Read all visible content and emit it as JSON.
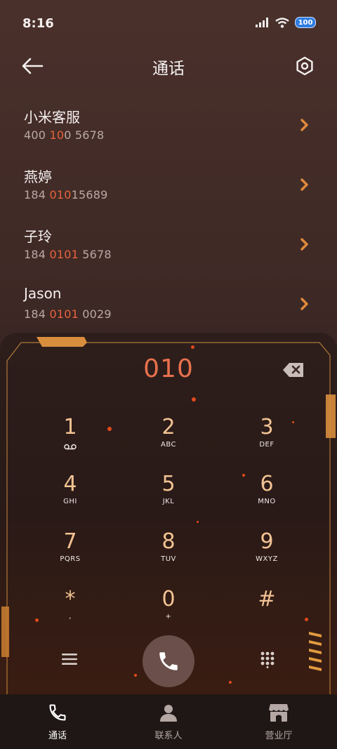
{
  "status": {
    "time": "8:16",
    "battery": "100"
  },
  "header": {
    "title": "通话"
  },
  "contacts": [
    {
      "name": "小米客服",
      "num_a": "400 ",
      "num_hl": "10",
      "num_b": "0 5678"
    },
    {
      "name": "燕婷",
      "num_a": "184 ",
      "num_hl": "010",
      "num_b": "15689"
    },
    {
      "name": "子玲",
      "num_a": "184 ",
      "num_hl": "0101",
      "num_b": " 5678"
    },
    {
      "name": "Jason",
      "num_a": "184 ",
      "num_hl": "0101",
      "num_b": " 0029"
    }
  ],
  "dialer": {
    "input": "010",
    "keys": [
      {
        "num": "1",
        "sub": ""
      },
      {
        "num": "2",
        "sub": "ABC"
      },
      {
        "num": "3",
        "sub": "DEF"
      },
      {
        "num": "4",
        "sub": "GHI"
      },
      {
        "num": "5",
        "sub": "JKL"
      },
      {
        "num": "6",
        "sub": "MNO"
      },
      {
        "num": "7",
        "sub": "PQRS"
      },
      {
        "num": "8",
        "sub": "TUV"
      },
      {
        "num": "9",
        "sub": "WXYZ"
      },
      {
        "num": "*",
        "sub": ","
      },
      {
        "num": "0",
        "sub": "+"
      },
      {
        "num": "#",
        "sub": ""
      }
    ]
  },
  "nav": {
    "calls": "通话",
    "contacts": "联系人",
    "store": "营业厅"
  },
  "colors": {
    "accent": "#e8714d",
    "key": "#f2c393",
    "frame": "#d69a4e"
  }
}
